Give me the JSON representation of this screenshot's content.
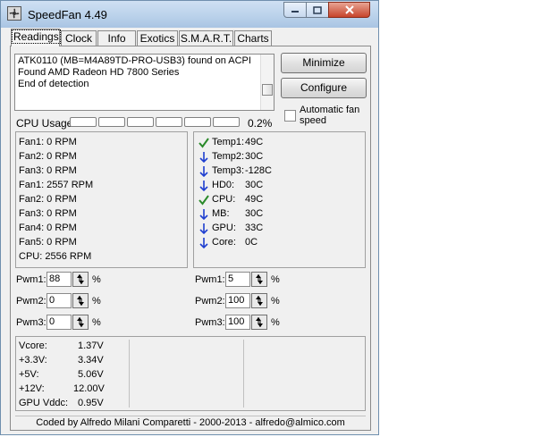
{
  "window": {
    "title": "SpeedFan 4.49"
  },
  "tabs": [
    "Readings",
    "Clock",
    "Info",
    "Exotics",
    "S.M.A.R.T.",
    "Charts"
  ],
  "log": [
    "ATK0110 (MB=M4A89TD-PRO-USB3) found on ACPI",
    "Found AMD Radeon HD 7800 Series",
    "End of detection"
  ],
  "buttons": {
    "minimize": "Minimize",
    "configure": "Configure"
  },
  "auto_fan": "Automatic fan speed",
  "cpu_usage": {
    "label": "CPU Usage",
    "value": "0.2%",
    "level": 0.002
  },
  "fans": [
    "Fan1: 0 RPM",
    "Fan2: 0 RPM",
    "Fan3: 0 RPM",
    "Fan1: 2557 RPM",
    "Fan2: 0 RPM",
    "Fan3: 0 RPM",
    "Fan4: 0 RPM",
    "Fan5: 0 RPM",
    "CPU:  2556 RPM"
  ],
  "temps": [
    {
      "label": "Temp1:",
      "value": "49C",
      "icon": "check-icon"
    },
    {
      "label": "Temp2:",
      "value": "30C",
      "icon": "arrow-down-icon"
    },
    {
      "label": "Temp3:",
      "value": "-128C",
      "icon": "arrow-down-icon"
    },
    {
      "label": "HD0:",
      "value": "30C",
      "icon": "arrow-down-icon"
    },
    {
      "label": "CPU:",
      "value": "49C",
      "icon": "check-icon"
    },
    {
      "label": "MB:",
      "value": "30C",
      "icon": "arrow-down-icon"
    },
    {
      "label": "GPU:",
      "value": "33C",
      "icon": "arrow-down-icon"
    },
    {
      "label": "Core:",
      "value": "0C",
      "icon": "arrow-down-icon"
    }
  ],
  "pwm_left": [
    {
      "label": "Pwm1:",
      "value": "88"
    },
    {
      "label": "Pwm2:",
      "value": "0"
    },
    {
      "label": "Pwm3:",
      "value": "0"
    }
  ],
  "pwm_right": [
    {
      "label": "Pwm1:",
      "value": "5"
    },
    {
      "label": "Pwm2:",
      "value": "100"
    },
    {
      "label": "Pwm3:",
      "value": "100"
    }
  ],
  "pct_symbol": "%",
  "voltages": [
    {
      "label": "Vcore:",
      "value": "1.37V"
    },
    {
      "label": "+3.3V:",
      "value": "3.34V"
    },
    {
      "label": "+5V:",
      "value": "5.06V"
    },
    {
      "label": "+12V:",
      "value": "12.00V"
    },
    {
      "label": "GPU Vddc:",
      "value": "0.95V"
    }
  ],
  "footer": "Coded by Alfredo Milani Comparetti - 2000-2013 - alfredo@almico.com",
  "colors": {
    "check": "#2a8a2a",
    "arrow": "#1f3fd0",
    "close_button": "#c7442b"
  }
}
